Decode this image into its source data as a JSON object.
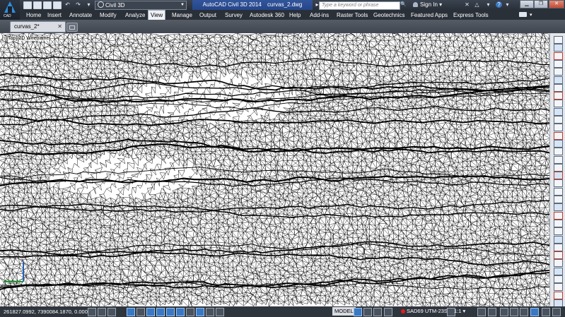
{
  "title_bar": {
    "workspace": "Civil 3D",
    "app_title": "AutoCAD Civil 3D 2014",
    "file_name": "curvas_2.dwg",
    "search_placeholder": "Type a keyword or phrase",
    "sign_in": "Sign In",
    "help": "?"
  },
  "ribbon_tabs": [
    "Home",
    "Insert",
    "Annotate",
    "Modify",
    "Analyze",
    "View",
    "Manage",
    "Output",
    "Survey",
    "Autodesk 360",
    "Help",
    "Add-ins",
    "Raster Tools",
    "Geotechnics",
    "Featured Apps",
    "Express Tools"
  ],
  "active_tab": "View",
  "file_tab": {
    "label": "curvas_2*",
    "close": "✕"
  },
  "viewport": {
    "label": "[-][Top][2D Wireframe]"
  },
  "status_bar": {
    "coordinates": "261827.0992, 7390084.1870, 0.0000",
    "model": "MODEL",
    "coordinate_system": "SAD69 UTM-23S",
    "scale": "1:1"
  },
  "colors": {
    "title_bg": "#2a3038",
    "app_title_bg": "#26458a",
    "mesh": "#000000",
    "active_tab_bg": "#eef1f5"
  }
}
